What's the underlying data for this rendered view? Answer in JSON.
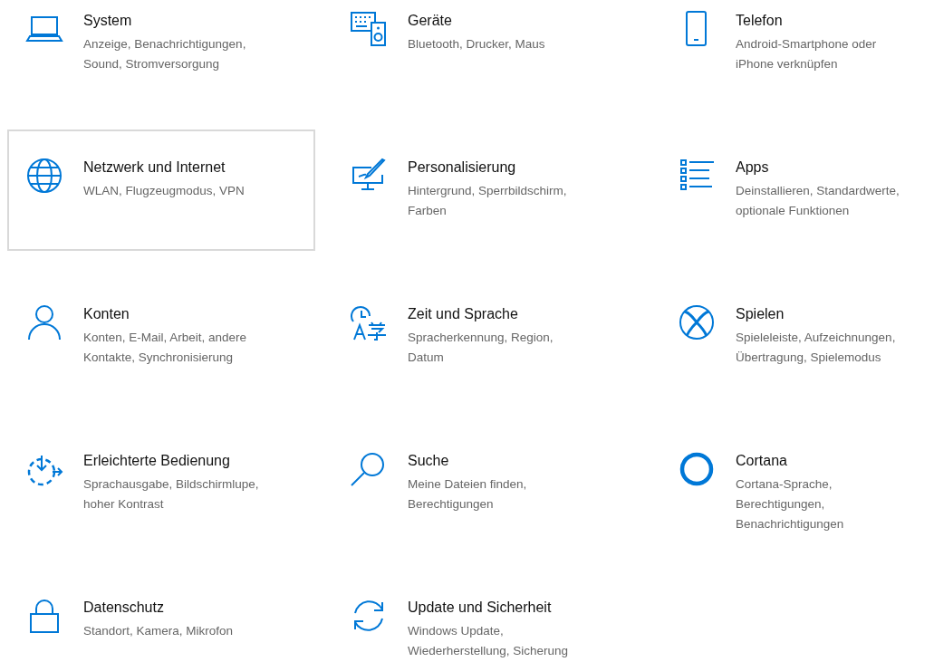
{
  "categories": [
    {
      "title": "System",
      "description": "Anzeige, Benachrichtigungen, Sound, Stromversorgung",
      "hovered": false
    },
    {
      "title": "Geräte",
      "description": "Bluetooth, Drucker, Maus",
      "hovered": false
    },
    {
      "title": "Telefon",
      "description": "Android-Smartphone oder iPhone verknüpfen",
      "hovered": false
    },
    {
      "title": "Netzwerk und Internet",
      "description": "WLAN, Flugzeugmodus, VPN",
      "hovered": true
    },
    {
      "title": "Personalisierung",
      "description": "Hintergrund, Sperrbildschirm, Farben",
      "hovered": false
    },
    {
      "title": "Apps",
      "description": "Deinstallieren, Standardwerte, optionale Funktionen",
      "hovered": false
    },
    {
      "title": "Konten",
      "description": "Konten, E-Mail, Arbeit, andere Kontakte, Synchronisierung",
      "hovered": false
    },
    {
      "title": "Zeit und Sprache",
      "description": "Spracherkennung, Region, Datum",
      "hovered": false
    },
    {
      "title": "Spielen",
      "description": "Spieleleiste, Aufzeichnungen, Übertragung, Spielemodus",
      "hovered": false
    },
    {
      "title": "Erleichterte Bedienung",
      "description": "Sprachausgabe, Bildschirmlupe, hoher Kontrast",
      "hovered": false
    },
    {
      "title": "Suche",
      "description": "Meine Dateien finden, Berechtigungen",
      "hovered": false
    },
    {
      "title": "Cortana",
      "description": "Cortana-Sprache, Berechtigungen, Benachrichtigungen",
      "hovered": false
    },
    {
      "title": "Datenschutz",
      "description": "Standort, Kamera, Mikrofon",
      "hovered": false
    },
    {
      "title": "Update und Sicherheit",
      "description": "Windows Update, Wiederherstellung, Sicherung",
      "hovered": false
    }
  ]
}
